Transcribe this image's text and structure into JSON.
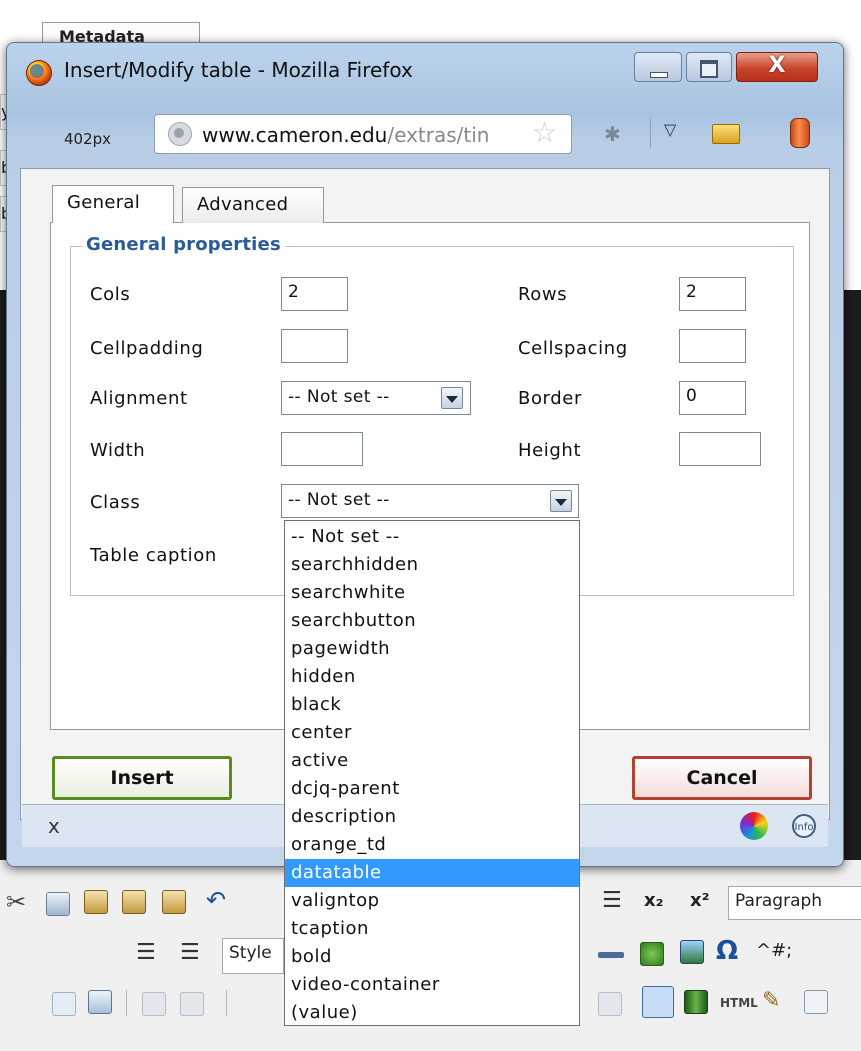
{
  "background": {
    "tab_stub": "Metadata",
    "left_stubs": [
      "y",
      "b",
      "b"
    ],
    "toolbar": {
      "row1_items": [
        "x₂",
        "x²"
      ],
      "row1_select": "Paragraph",
      "row2_select": "Style",
      "row2_text": "^#;",
      "row3_text": "HTML"
    }
  },
  "window": {
    "title": "Insert/Modify table - Mozilla Firefox",
    "size_label": "402px",
    "url_domain": "www.cameron.edu",
    "url_path": "/extras/tin",
    "close_glyph": "X"
  },
  "dialog": {
    "tabs": [
      {
        "label": "General",
        "active": true
      },
      {
        "label": "Advanced",
        "active": false
      }
    ],
    "legend": "General properties",
    "fields": {
      "cols": {
        "label": "Cols",
        "value": "2"
      },
      "rows": {
        "label": "Rows",
        "value": "2"
      },
      "cellpadding": {
        "label": "Cellpadding",
        "value": ""
      },
      "cellspacing": {
        "label": "Cellspacing",
        "value": ""
      },
      "alignment": {
        "label": "Alignment",
        "value": "-- Not set --"
      },
      "border": {
        "label": "Border",
        "value": "0"
      },
      "width": {
        "label": "Width",
        "value": ""
      },
      "height": {
        "label": "Height",
        "value": ""
      },
      "class": {
        "label": "Class",
        "value": "-- Not set --"
      },
      "caption": {
        "label": "Table caption"
      }
    },
    "class_options": [
      "-- Not set --",
      "searchhidden",
      "searchwhite",
      "searchbutton",
      "pagewidth",
      "hidden",
      "black",
      "center",
      "active",
      "dcjq-parent",
      "description",
      "orange_td",
      "datatable",
      "valigntop",
      "tcaption",
      "bold",
      "video-container",
      "(value)"
    ],
    "highlighted_option": "datatable",
    "buttons": {
      "insert": "Insert",
      "cancel": "Cancel"
    },
    "status": {
      "close": "x",
      "info": "Info"
    }
  }
}
